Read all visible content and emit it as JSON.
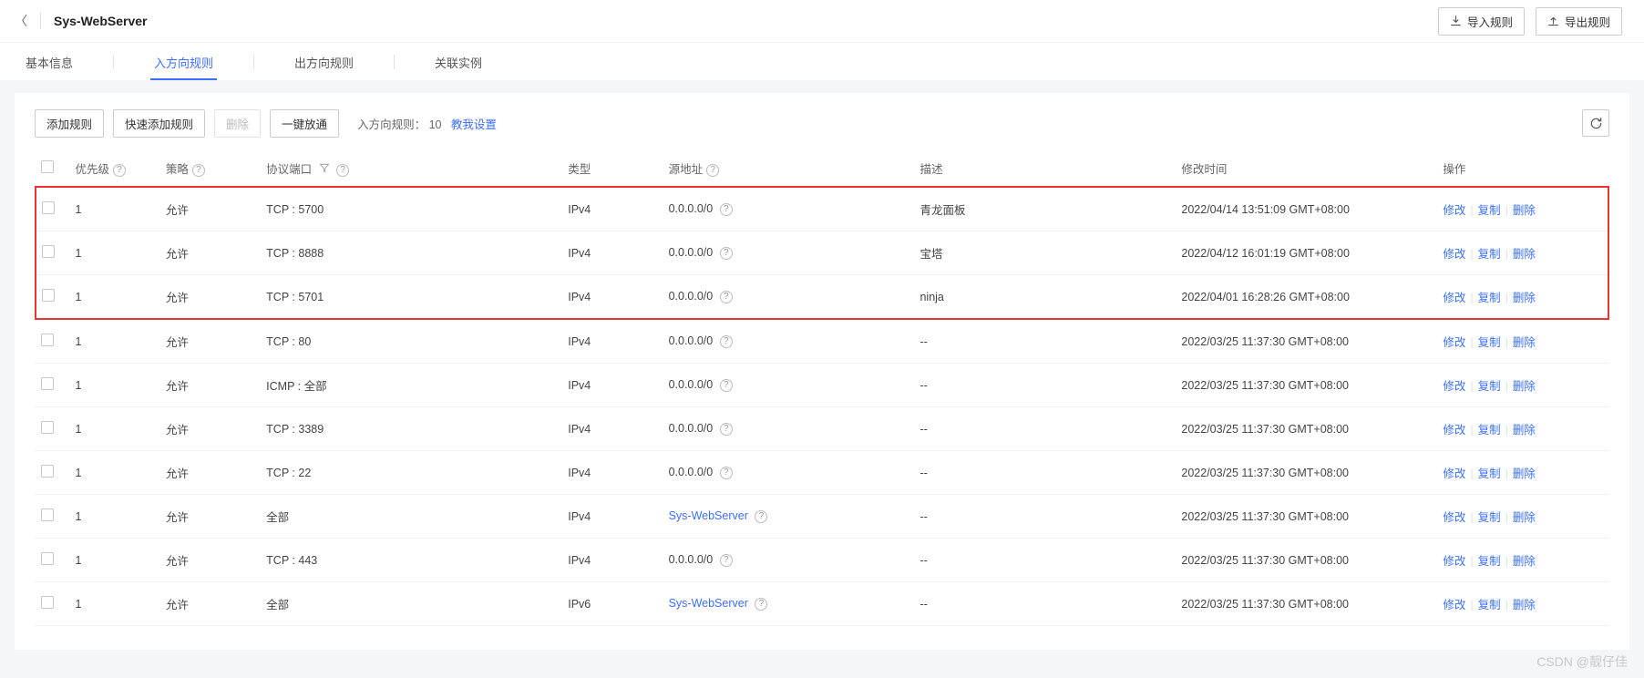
{
  "header": {
    "title": "Sys-WebServer",
    "import_btn": "导入规则",
    "export_btn": "导出规则"
  },
  "tabs": [
    {
      "label": "基本信息",
      "active": false
    },
    {
      "label": "入方向规则",
      "active": true
    },
    {
      "label": "出方向规则",
      "active": false
    },
    {
      "label": "关联实例",
      "active": false
    }
  ],
  "toolbar": {
    "add": "添加规则",
    "quick_add": "快速添加规则",
    "delete": "删除",
    "one_click": "一键放通",
    "count_label": "入方向规则：",
    "count_value": "10",
    "help_link": "教我设置"
  },
  "columns": {
    "priority": "优先级",
    "policy": "策略",
    "protocol": "协议端口",
    "type": "类型",
    "source": "源地址",
    "desc": "描述",
    "time": "修改时间",
    "action": "操作"
  },
  "actions": {
    "modify": "修改",
    "copy": "复制",
    "delete": "删除"
  },
  "rows": [
    {
      "priority": "1",
      "policy": "允许",
      "protocol": "TCP : 5700",
      "type": "IPv4",
      "source": "0.0.0.0/0",
      "source_help": true,
      "desc": "青龙面板",
      "time": "2022/04/14 13:51:09 GMT+08:00",
      "highlight": true
    },
    {
      "priority": "1",
      "policy": "允许",
      "protocol": "TCP : 8888",
      "type": "IPv4",
      "source": "0.0.0.0/0",
      "source_help": true,
      "desc": "宝塔",
      "time": "2022/04/12 16:01:19 GMT+08:00",
      "highlight": true
    },
    {
      "priority": "1",
      "policy": "允许",
      "protocol": "TCP : 5701",
      "type": "IPv4",
      "source": "0.0.0.0/0",
      "source_help": true,
      "desc": "ninja",
      "time": "2022/04/01 16:28:26 GMT+08:00",
      "highlight": true
    },
    {
      "priority": "1",
      "policy": "允许",
      "protocol": "TCP : 80",
      "type": "IPv4",
      "source": "0.0.0.0/0",
      "source_help": true,
      "desc": "--",
      "time": "2022/03/25 11:37:30 GMT+08:00"
    },
    {
      "priority": "1",
      "policy": "允许",
      "protocol": "ICMP : 全部",
      "type": "IPv4",
      "source": "0.0.0.0/0",
      "source_help": true,
      "desc": "--",
      "time": "2022/03/25 11:37:30 GMT+08:00"
    },
    {
      "priority": "1",
      "policy": "允许",
      "protocol": "TCP : 3389",
      "type": "IPv4",
      "source": "0.0.0.0/0",
      "source_help": true,
      "desc": "--",
      "time": "2022/03/25 11:37:30 GMT+08:00"
    },
    {
      "priority": "1",
      "policy": "允许",
      "protocol": "TCP : 22",
      "type": "IPv4",
      "source": "0.0.0.0/0",
      "source_help": true,
      "desc": "--",
      "time": "2022/03/25 11:37:30 GMT+08:00"
    },
    {
      "priority": "1",
      "policy": "允许",
      "protocol": "全部",
      "type": "IPv4",
      "source": "Sys-WebServer",
      "source_link": true,
      "source_help": true,
      "desc": "--",
      "time": "2022/03/25 11:37:30 GMT+08:00"
    },
    {
      "priority": "1",
      "policy": "允许",
      "protocol": "TCP : 443",
      "type": "IPv4",
      "source": "0.0.0.0/0",
      "source_help": true,
      "desc": "--",
      "time": "2022/03/25 11:37:30 GMT+08:00"
    },
    {
      "priority": "1",
      "policy": "允许",
      "protocol": "全部",
      "type": "IPv6",
      "source": "Sys-WebServer",
      "source_link": true,
      "source_help": true,
      "desc": "--",
      "time": "2022/03/25 11:37:30 GMT+08:00"
    }
  ],
  "watermark": "CSDN @靓仔佳"
}
